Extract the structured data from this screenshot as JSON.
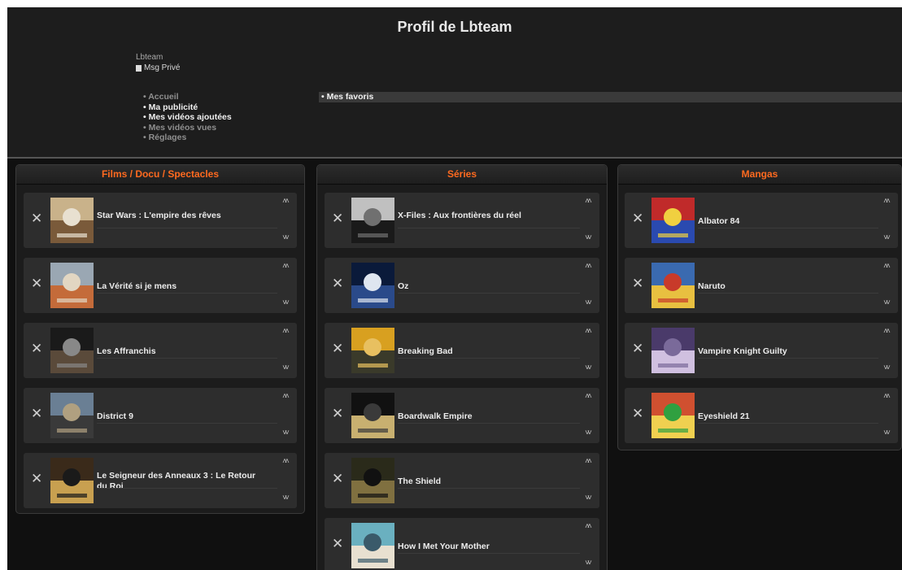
{
  "page": {
    "title": "Profil de Lbteam",
    "username": "Lbteam",
    "private_msg": "Msg Privé"
  },
  "nav": {
    "items": [
      {
        "label": "• Accueil",
        "active": false
      },
      {
        "label": "• Ma publicité",
        "active": true
      },
      {
        "label": "• Mes vidéos ajoutées",
        "active": true
      },
      {
        "label": "• Mes vidéos vues",
        "active": false
      },
      {
        "label": "• Réglages",
        "active": false
      }
    ],
    "favorites_label": "• Mes favoris"
  },
  "icons": {
    "remove": "close-icon",
    "move_up": "double-chevron-up-icon",
    "move_down": "double-chevron-down-icon",
    "msg": "document-icon"
  },
  "colors": {
    "column_header": "#ff6a1f",
    "background": "#101010",
    "card": "#2d2d2d"
  },
  "columns": [
    {
      "title": "Films / Docu / Spectacles",
      "items": [
        {
          "title": "Star Wars : L'empire des rêves"
        },
        {
          "title": "La Vérité si je mens"
        },
        {
          "title": "Les Affranchis"
        },
        {
          "title": "District 9"
        },
        {
          "title": "Le Seigneur des Anneaux 3 : Le Retour du Roi"
        }
      ]
    },
    {
      "title": "Séries",
      "items": [
        {
          "title": "X-Files : Aux frontières du réel"
        },
        {
          "title": "Oz"
        },
        {
          "title": "Breaking Bad"
        },
        {
          "title": "Boardwalk Empire"
        },
        {
          "title": "The Shield"
        },
        {
          "title": "How I Met Your Mother"
        }
      ]
    },
    {
      "title": "Mangas",
      "items": [
        {
          "title": "Albator 84"
        },
        {
          "title": "Naruto"
        },
        {
          "title": "Vampire Knight Guilty"
        },
        {
          "title": "Eyeshield 21"
        }
      ]
    }
  ]
}
